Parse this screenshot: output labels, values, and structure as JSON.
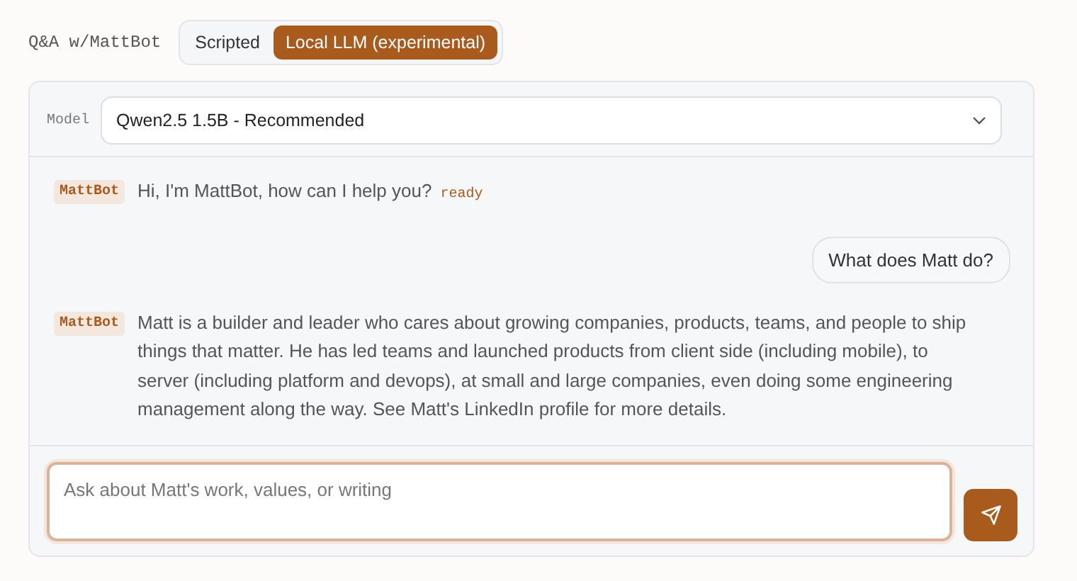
{
  "header": {
    "title": "Q&A w/MattBot",
    "modes": [
      {
        "label": "Scripted",
        "selected": false
      },
      {
        "label": "Local LLM (experimental)",
        "selected": true
      }
    ]
  },
  "model": {
    "label": "Model",
    "value": "Qwen2.5 1.5B - Recommended"
  },
  "messages": [
    {
      "kind": "bot",
      "sender": "MattBot",
      "text": "Hi, I'm MattBot, how can I help you?",
      "status": "ready"
    },
    {
      "kind": "user",
      "text": "What does Matt do?"
    },
    {
      "kind": "bot",
      "sender": "MattBot",
      "text": "Matt is a builder and leader who cares about growing companies, products, teams, and people to ship things that matter. He has led teams and launched products from client side (including mobile), to server (including platform and devops), at small and large companies, even doing some engineering management along the way. See Matt's LinkedIn profile for more details."
    }
  ],
  "composer": {
    "placeholder": "Ask about Matt's work, values, or writing"
  }
}
